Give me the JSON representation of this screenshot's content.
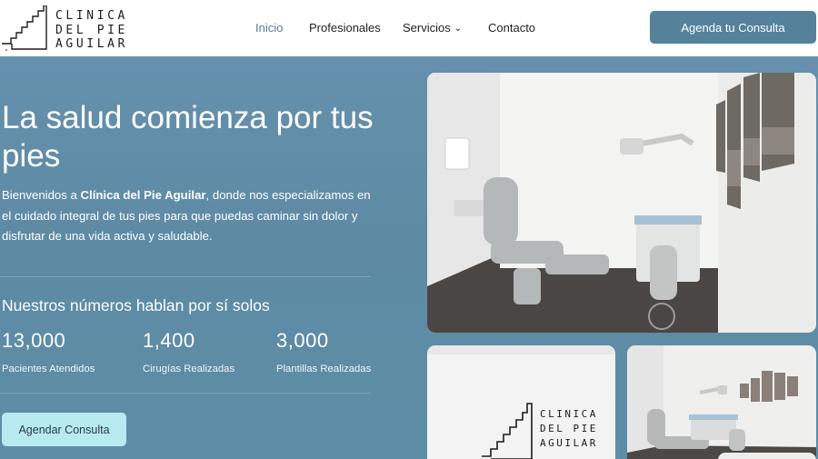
{
  "brand": {
    "logo_lines": [
      "CLINICA",
      "DEL PIE",
      "AGUILAR"
    ]
  },
  "nav": {
    "items": [
      {
        "label": "Inicio",
        "active": true
      },
      {
        "label": "Profesionales",
        "active": false
      },
      {
        "label": "Servicios",
        "active": false,
        "has_dropdown": true
      },
      {
        "label": "Contacto",
        "active": false
      }
    ],
    "cta_label": "Agenda tu Consulta"
  },
  "hero": {
    "title": "La salud comienza por tus pies",
    "intro_before": "Bienvenidos a ",
    "intro_bold": "Clínica del Pie Aguilar",
    "intro_after": ", donde nos especializamos en el cuidado integral de tus pies para que puedas caminar sin dolor y disfrutar de una vida activa y saludable.",
    "numbers_title": "Nuestros números hablan por sí solos",
    "stats": [
      {
        "value": "13,000",
        "label": "Pacientes Atendidos"
      },
      {
        "value": "1,400",
        "label": "Cirugías Realizadas"
      },
      {
        "value": "3,000",
        "label": "Plantillas Realizadas"
      }
    ],
    "cta_label": "Agendar Consulta"
  },
  "gallery": {
    "images": [
      "clinic-room-photo",
      "clinic-logo-wall-photo",
      "clinic-room-secondary-photo"
    ]
  },
  "colors": {
    "accent": "#55819a",
    "hero_bg": "#6691ae",
    "hero_cta_bg": "#b7eaf1",
    "nav_active": "#4f7e9c"
  }
}
